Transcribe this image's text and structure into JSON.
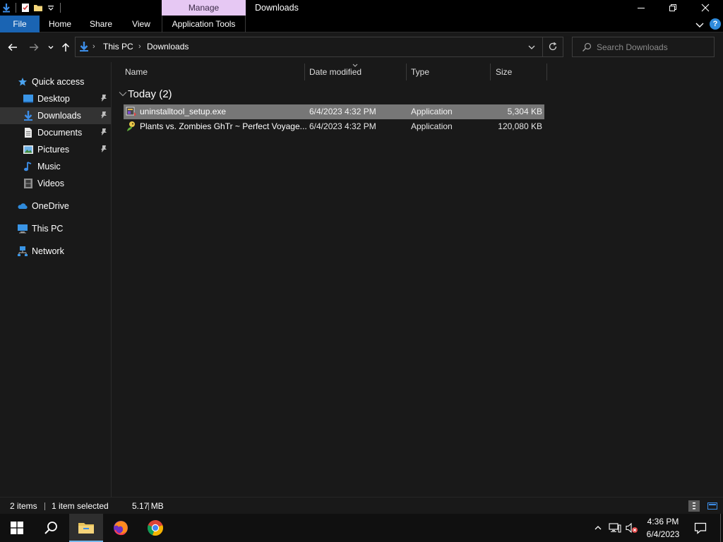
{
  "window": {
    "title": "Downloads",
    "context_tab": "Manage"
  },
  "ribbon": {
    "tabs": [
      "File",
      "Home",
      "Share",
      "View",
      "Application Tools"
    ]
  },
  "address": {
    "path": [
      "This PC",
      "Downloads"
    ]
  },
  "search": {
    "placeholder": "Search Downloads"
  },
  "sidebar": {
    "quick_access": "Quick access",
    "items": [
      {
        "label": "Desktop",
        "pinned": true
      },
      {
        "label": "Downloads",
        "pinned": true,
        "selected": true
      },
      {
        "label": "Documents",
        "pinned": true
      },
      {
        "label": "Pictures",
        "pinned": true
      },
      {
        "label": "Music",
        "pinned": false
      },
      {
        "label": "Videos",
        "pinned": false
      }
    ],
    "onedrive": "OneDrive",
    "this_pc": "This PC",
    "network": "Network"
  },
  "columns": {
    "name": "Name",
    "date": "Date modified",
    "type": "Type",
    "size": "Size"
  },
  "group": {
    "label": "Today (2)"
  },
  "files": [
    {
      "name": "uninstalltool_setup.exe",
      "date": "6/4/2023 4:32 PM",
      "type": "Application",
      "size": "5,304 KB",
      "selected": true
    },
    {
      "name": "Plants vs. Zombies GhTr ~ Perfect Voyage...",
      "date": "6/4/2023 4:32 PM",
      "type": "Application",
      "size": "120,080 KB",
      "selected": false
    }
  ],
  "status": {
    "count": "2 items",
    "selection": "1 item selected",
    "selection_size": "5.17 MB"
  },
  "clock": {
    "time": "4:36 PM",
    "date": "6/4/2023"
  },
  "colors": {
    "accent": "#1a64b3",
    "manage_tab": "#e6c8f3",
    "selection": "#777777",
    "folder_icon": "#e8c35a"
  }
}
